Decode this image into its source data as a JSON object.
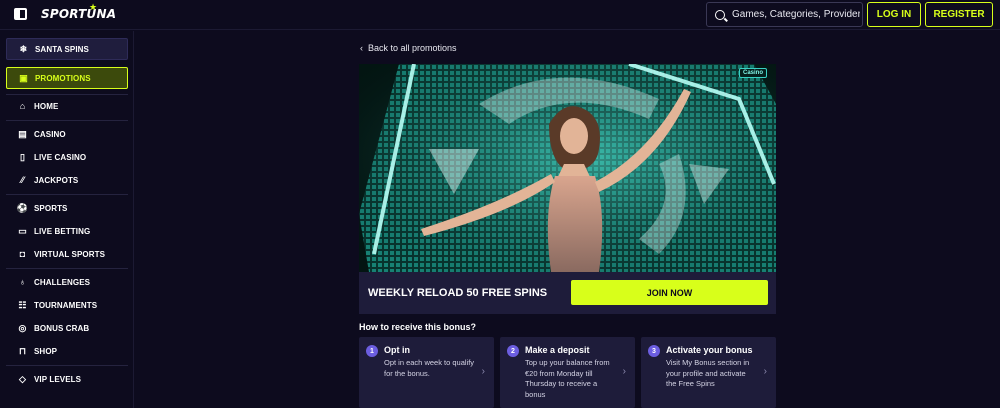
{
  "header": {
    "logo_text": "SPORTUNA",
    "search_placeholder": "Games, Categories, Providers",
    "login_label": "LOG IN",
    "register_label": "REGISTER",
    "accent_color": "#d8ff1a"
  },
  "sidebar": {
    "items": [
      {
        "label": "SANTA SPINS",
        "icon": "snowflake-icon"
      },
      {
        "label": "PROMOTIONS",
        "icon": "gift-icon"
      },
      {
        "label": "HOME",
        "icon": "home-icon"
      },
      {
        "label": "CASINO",
        "icon": "slot-icon"
      },
      {
        "label": "LIVE CASINO",
        "icon": "phone-icon"
      },
      {
        "label": "JACKPOTS",
        "icon": "jackpot-icon"
      },
      {
        "label": "SPORTS",
        "icon": "ball-icon"
      },
      {
        "label": "LIVE BETTING",
        "icon": "tv-icon"
      },
      {
        "label": "VIRTUAL SPORTS",
        "icon": "controller-icon"
      },
      {
        "label": "CHALLENGES",
        "icon": "trophy-icon"
      },
      {
        "label": "TOURNAMENTS",
        "icon": "people-icon"
      },
      {
        "label": "BONUS CRAB",
        "icon": "claw-icon"
      },
      {
        "label": "SHOP",
        "icon": "bag-icon"
      },
      {
        "label": "VIP LEVELS",
        "icon": "diamond-icon"
      }
    ]
  },
  "main": {
    "back_label": "Back to all promotions",
    "badge": "Casino",
    "promo_title": "WEEKLY RELOAD 50 FREE SPINS",
    "join_label": "JOIN NOW",
    "how_title": "How to receive this bonus?",
    "steps": [
      {
        "num": "1",
        "title": "Opt in",
        "desc": "Opt in each week to qualify for the bonus."
      },
      {
        "num": "2",
        "title": "Make a deposit",
        "desc": "Top up your balance from €20 from Monday till Thursday to receive a bonus"
      },
      {
        "num": "3",
        "title": "Activate your bonus",
        "desc": "Visit My Bonus section in your profile and activate the Free Spins"
      }
    ]
  }
}
